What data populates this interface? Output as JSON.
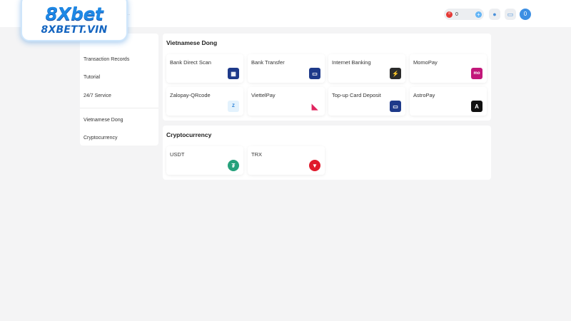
{
  "header": {
    "logo_main": "8Xbet",
    "logo_sub": "8XBETT.VIN",
    "faint_link": "...",
    "balance": "0",
    "avatar_letter": "0"
  },
  "sidebar": {
    "items": [
      {
        "label": "Transaction Records"
      },
      {
        "label": "Tutorial"
      },
      {
        "label": "24/7 Service"
      },
      {
        "label": "Vietnamese Dong"
      },
      {
        "label": "Cryptocurrency"
      }
    ]
  },
  "sections": {
    "vnd": {
      "title": "Vietnamese Dong",
      "methods": [
        {
          "label": "Bank Direct Scan",
          "icon": "bank-scan-icon"
        },
        {
          "label": "Bank Transfer",
          "icon": "bank-transfer-icon"
        },
        {
          "label": "Internet Banking",
          "icon": "internet-banking-icon"
        },
        {
          "label": "MomoPay",
          "icon": "momo-icon"
        },
        {
          "label": "Zalopay-QRcode",
          "icon": "zalopay-icon"
        },
        {
          "label": "ViettelPay",
          "icon": "viettelpay-icon"
        },
        {
          "label": "Top-up Card Deposit",
          "icon": "card-icon"
        },
        {
          "label": "AstroPay",
          "icon": "astropay-icon"
        }
      ]
    },
    "crypto": {
      "title": "Cryptocurrency",
      "methods": [
        {
          "label": "USDT",
          "icon": "usdt-icon"
        },
        {
          "label": "TRX",
          "icon": "trx-icon"
        }
      ]
    }
  },
  "colors": {
    "accent": "#3d8fe3",
    "background": "#f4f4f5"
  }
}
